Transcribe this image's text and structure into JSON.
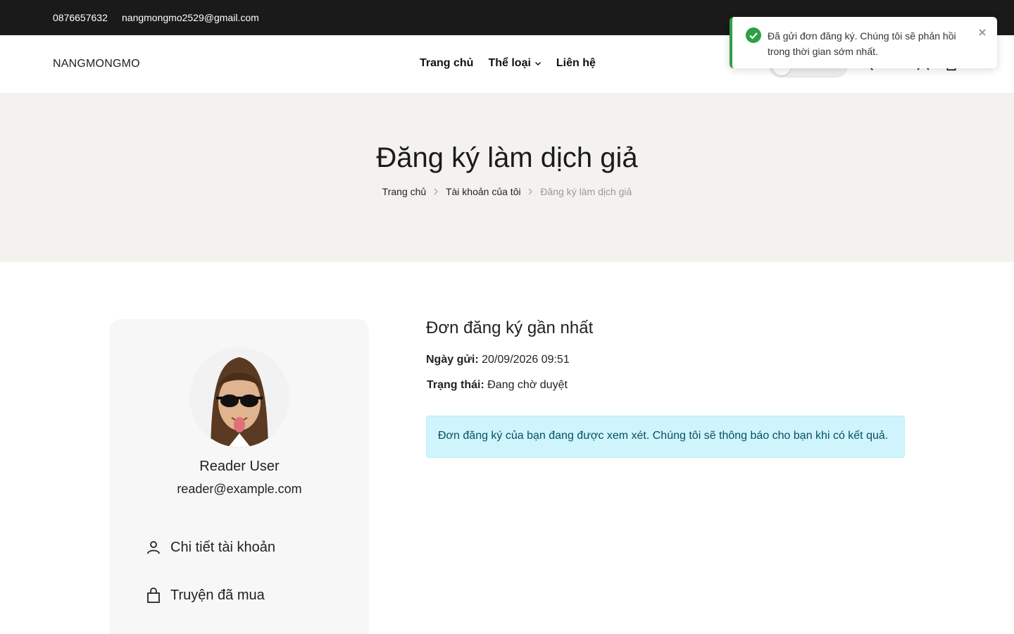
{
  "topbar": {
    "phone": "0876657632",
    "email": "nangmongmo2529@gmail.com"
  },
  "header": {
    "logo": "NANGMONGMO",
    "nav": [
      {
        "label": "Trang chủ"
      },
      {
        "label": "Thể loại",
        "icon": "chevron-down-icon"
      },
      {
        "label": "Liên hệ"
      }
    ],
    "icons": [
      "theme-toggle",
      "search-icon",
      "user-icon",
      "cart-icon"
    ]
  },
  "hero": {
    "title": "Đăng ký làm dịch giả",
    "breadcrumb": [
      "Trang chủ",
      "Tài khoản của tôi",
      "Đăng ký làm dịch giả"
    ]
  },
  "profile": {
    "name": "Reader User",
    "email": "reader@example.com",
    "menu": [
      {
        "label": "Chi tiết tài khoản",
        "icon": "user-icon"
      },
      {
        "label": "Truyện đã mua",
        "icon": "shopping-bag-icon"
      }
    ]
  },
  "application": {
    "heading": "Đơn đăng ký gần nhất",
    "date_label": "Ngày gửi:",
    "date_value": "20/09/2026 09:51",
    "status_label": "Trạng thái:",
    "status_value": "Đang chờ duyệt",
    "notice": "Đơn đăng ký của bạn đang được xem xét. Chúng tôi sẽ thông báo cho bạn khi có kết quả."
  },
  "toast": {
    "message": "Đã gửi đơn đăng ký. Chúng tôi sẽ phản hồi trong thời gian sớm nhất.",
    "color": "#2ea043"
  },
  "colors": {
    "topbar": "#1a1a1a",
    "hero": "#f3f2ee",
    "info_bg": "#cff4fc",
    "info_text": "#055160"
  }
}
